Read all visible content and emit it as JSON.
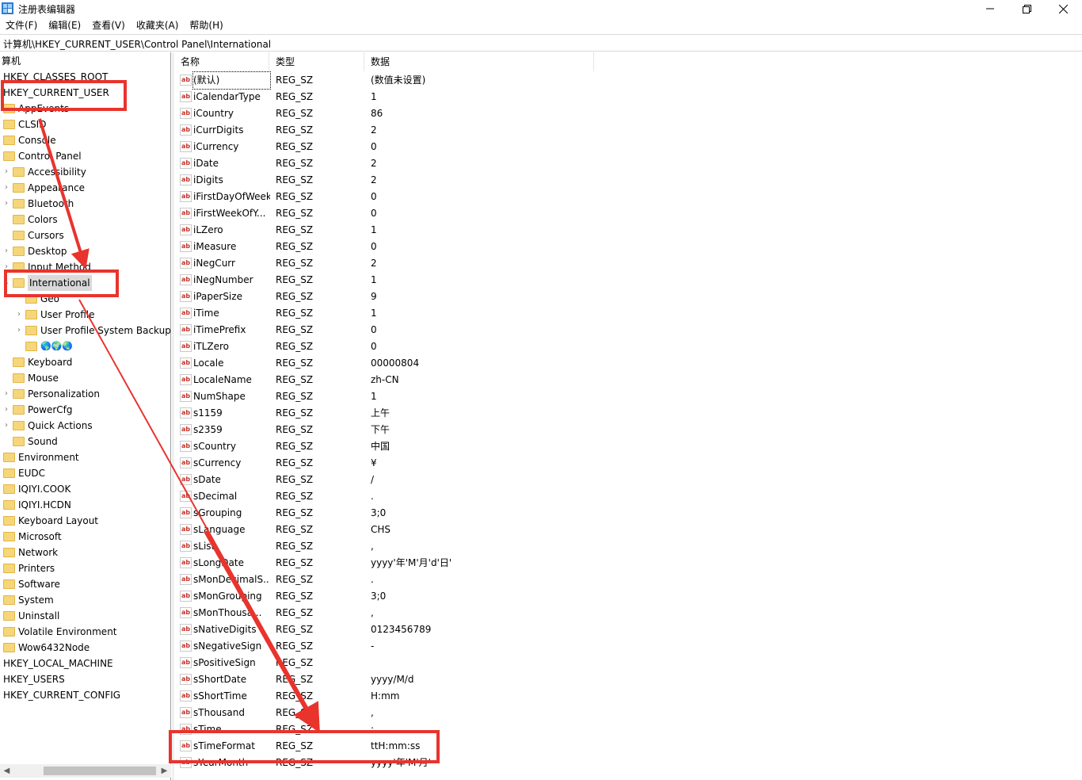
{
  "window": {
    "title": "注册表编辑器",
    "controls": {
      "minimize": "—",
      "maximize": "❐",
      "close": "✕"
    }
  },
  "menu": [
    "文件(F)",
    "编辑(E)",
    "查看(V)",
    "收藏夹(A)",
    "帮助(H)"
  ],
  "address": "计算机\\HKEY_CURRENT_USER\\Control Panel\\International",
  "tree": {
    "root": "算机",
    "hkcr": "HKEY_CLASSES_ROOT",
    "hkcu": "HKEY_CURRENT_USER",
    "appevents": "AppEvents",
    "clsid": "CLSID",
    "console": "Console",
    "control_panel": "Control Panel",
    "accessibility": "Accessibility",
    "appearance": "Appearance",
    "bluetooth": "Bluetooth",
    "colors": "Colors",
    "cursors": "Cursors",
    "desktop": "Desktop",
    "input_method": "Input Method",
    "international": "International",
    "geo": "Geo",
    "user_profile": "User Profile",
    "user_profile_backup": "User Profile System Backup",
    "globes": "🌎🌍🌏",
    "keyboard": "Keyboard",
    "mouse": "Mouse",
    "personalization": "Personalization",
    "powercfg": "PowerCfg",
    "quick_actions": "Quick Actions",
    "sound": "Sound",
    "environment": "Environment",
    "eudc": "EUDC",
    "iqiyi_cook": "IQIYI.COOK",
    "iqiyi_hcdn": "IQIYI.HCDN",
    "keyboard_layout": "Keyboard Layout",
    "microsoft": "Microsoft",
    "network": "Network",
    "printers": "Printers",
    "software": "Software",
    "system": "System",
    "uninstall": "Uninstall",
    "volatile": "Volatile Environment",
    "wow": "Wow6432Node",
    "hklm": "HKEY_LOCAL_MACHINE",
    "hku": "HKEY_USERS",
    "hkcc": "HKEY_CURRENT_CONFIG"
  },
  "columns": {
    "name": "名称",
    "type": "类型",
    "data": "数据"
  },
  "icon_text": "ab",
  "values": [
    {
      "name": "(默认)",
      "type": "REG_SZ",
      "data": "(数值未设置)"
    },
    {
      "name": "iCalendarType",
      "type": "REG_SZ",
      "data": "1"
    },
    {
      "name": "iCountry",
      "type": "REG_SZ",
      "data": "86"
    },
    {
      "name": "iCurrDigits",
      "type": "REG_SZ",
      "data": "2"
    },
    {
      "name": "iCurrency",
      "type": "REG_SZ",
      "data": "0"
    },
    {
      "name": "iDate",
      "type": "REG_SZ",
      "data": "2"
    },
    {
      "name": "iDigits",
      "type": "REG_SZ",
      "data": "2"
    },
    {
      "name": "iFirstDayOfWeek",
      "type": "REG_SZ",
      "data": "0"
    },
    {
      "name": "iFirstWeekOfY...",
      "type": "REG_SZ",
      "data": "0"
    },
    {
      "name": "iLZero",
      "type": "REG_SZ",
      "data": "1"
    },
    {
      "name": "iMeasure",
      "type": "REG_SZ",
      "data": "0"
    },
    {
      "name": "iNegCurr",
      "type": "REG_SZ",
      "data": "2"
    },
    {
      "name": "iNegNumber",
      "type": "REG_SZ",
      "data": "1"
    },
    {
      "name": "iPaperSize",
      "type": "REG_SZ",
      "data": "9"
    },
    {
      "name": "iTime",
      "type": "REG_SZ",
      "data": "1"
    },
    {
      "name": "iTimePrefix",
      "type": "REG_SZ",
      "data": "0"
    },
    {
      "name": "iTLZero",
      "type": "REG_SZ",
      "data": "0"
    },
    {
      "name": "Locale",
      "type": "REG_SZ",
      "data": "00000804"
    },
    {
      "name": "LocaleName",
      "type": "REG_SZ",
      "data": "zh-CN"
    },
    {
      "name": "NumShape",
      "type": "REG_SZ",
      "data": "1"
    },
    {
      "name": "s1159",
      "type": "REG_SZ",
      "data": "上午"
    },
    {
      "name": "s2359",
      "type": "REG_SZ",
      "data": "下午"
    },
    {
      "name": "sCountry",
      "type": "REG_SZ",
      "data": "中国"
    },
    {
      "name": "sCurrency",
      "type": "REG_SZ",
      "data": "¥"
    },
    {
      "name": "sDate",
      "type": "REG_SZ",
      "data": "/"
    },
    {
      "name": "sDecimal",
      "type": "REG_SZ",
      "data": "."
    },
    {
      "name": "sGrouping",
      "type": "REG_SZ",
      "data": "3;0"
    },
    {
      "name": "sLanguage",
      "type": "REG_SZ",
      "data": "CHS"
    },
    {
      "name": "sList",
      "type": "REG_SZ",
      "data": ","
    },
    {
      "name": "sLongDate",
      "type": "REG_SZ",
      "data": "yyyy'年'M'月'd'日'"
    },
    {
      "name": "sMonDecimalS...",
      "type": "REG_SZ",
      "data": "."
    },
    {
      "name": "sMonGrouping",
      "type": "REG_SZ",
      "data": "3;0"
    },
    {
      "name": "sMonThousa...",
      "type": "REG_SZ",
      "data": ","
    },
    {
      "name": "sNativeDigits",
      "type": "REG_SZ",
      "data": "0123456789"
    },
    {
      "name": "sNegativeSign",
      "type": "REG_SZ",
      "data": "-"
    },
    {
      "name": "sPositiveSign",
      "type": "REG_SZ",
      "data": ""
    },
    {
      "name": "sShortDate",
      "type": "REG_SZ",
      "data": "yyyy/M/d"
    },
    {
      "name": "sShortTime",
      "type": "REG_SZ",
      "data": "H:mm"
    },
    {
      "name": "sThousand",
      "type": "REG_SZ",
      "data": ","
    },
    {
      "name": "sTime",
      "type": "REG_SZ",
      "data": ":"
    },
    {
      "name": "sTimeFormat",
      "type": "REG_SZ",
      "data": "ttH:mm:ss"
    },
    {
      "name": "sYearMonth",
      "type": "REG_SZ",
      "data": "yyyy'年'M'月'"
    }
  ],
  "colors": {
    "annotation": "#e8342d",
    "folder": "#f6d67a",
    "selection": "#d9d9d9"
  }
}
